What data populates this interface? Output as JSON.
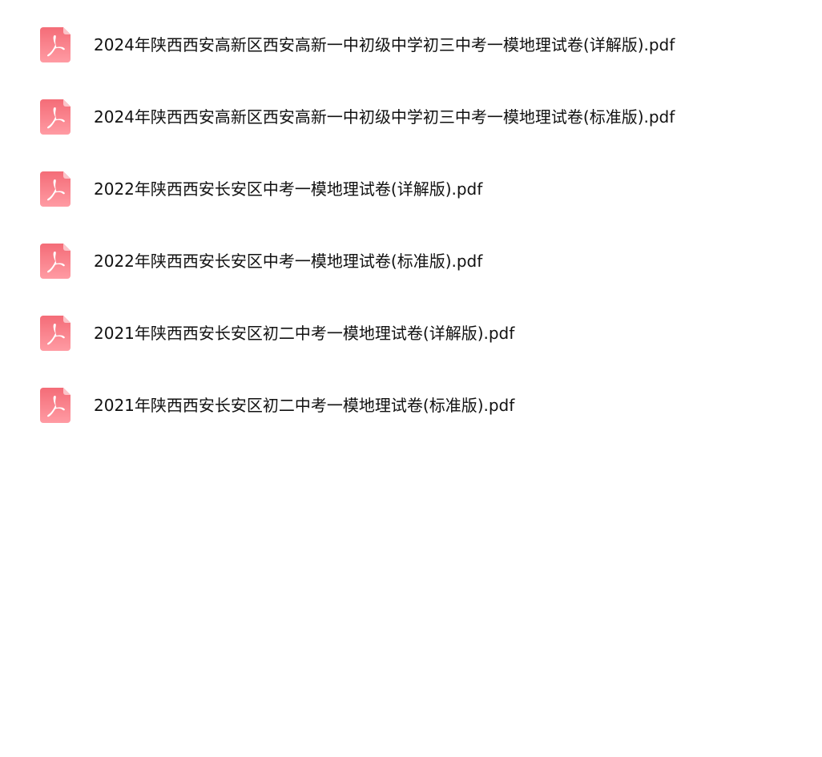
{
  "files": [
    {
      "name": "2024年陕西西安高新区西安高新一中初级中学初三中考一模地理试卷(详解版).pdf",
      "icon": "pdf-file-icon"
    },
    {
      "name": "2024年陕西西安高新区西安高新一中初级中学初三中考一模地理试卷(标准版).pdf",
      "icon": "pdf-file-icon"
    },
    {
      "name": "2022年陕西西安长安区中考一模地理试卷(详解版).pdf",
      "icon": "pdf-file-icon"
    },
    {
      "name": "2022年陕西西安长安区中考一模地理试卷(标准版).pdf",
      "icon": "pdf-file-icon"
    },
    {
      "name": "2021年陕西西安长安区初二中考一模地理试卷(详解版).pdf",
      "icon": "pdf-file-icon"
    },
    {
      "name": "2021年陕西西安长安区初二中考一模地理试卷(标准版).pdf",
      "icon": "pdf-file-icon"
    }
  ],
  "colors": {
    "icon_top": "#f5707a",
    "icon_bottom": "#ff9aa2",
    "icon_fold": "#fbc4c9",
    "text": "#111111"
  }
}
